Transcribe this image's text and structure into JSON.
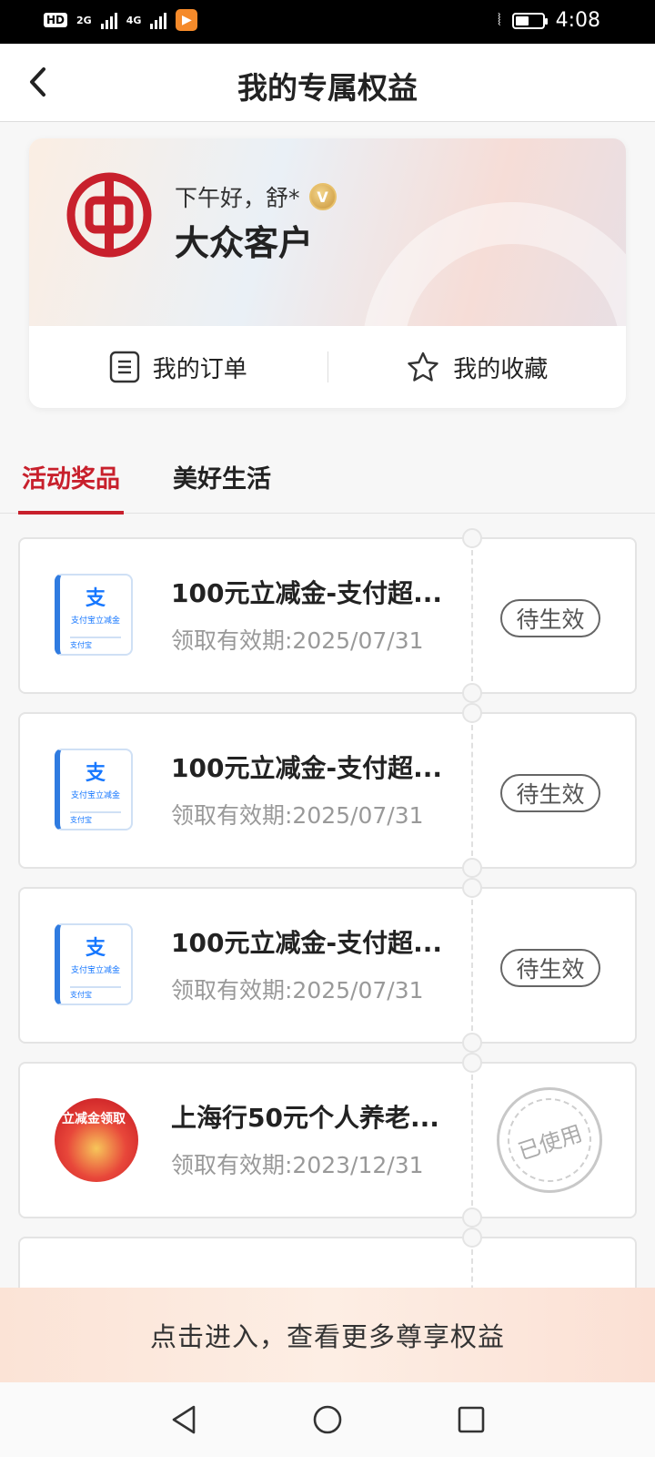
{
  "status_bar": {
    "hd": "HD",
    "net1": "2G",
    "net2": "4G",
    "time": "4:08"
  },
  "header": {
    "title": "我的专属权益"
  },
  "profile": {
    "greeting": "下午好，舒*",
    "vip_badge": "V",
    "tier": "大众客户",
    "orders_label": "我的订单",
    "favorites_label": "我的收藏"
  },
  "tabs": [
    {
      "label": "活动奖品",
      "active": true
    },
    {
      "label": "美好生活",
      "active": false
    }
  ],
  "coupons": [
    {
      "title": "100元立减金-支付超...",
      "date": "领取有效期:2025/07/31",
      "status": "待生效",
      "thumb": "alipay-coupon"
    },
    {
      "title": "100元立减金-支付超...",
      "date": "领取有效期:2025/07/31",
      "status": "待生效",
      "thumb": "alipay-coupon"
    },
    {
      "title": "100元立减金-支付超...",
      "date": "领取有效期:2025/07/31",
      "status": "待生效",
      "thumb": "alipay-coupon"
    },
    {
      "title": "上海行50元个人养老...",
      "date": "领取有效期:2023/12/31",
      "status": "已使用",
      "thumb": "promo-image"
    }
  ],
  "alipay_thumb": {
    "glyph": "支",
    "caption": "支付宝立减金",
    "footer": "支付宝"
  },
  "promo_thumb": {
    "caption": "立减金领取"
  },
  "bottom_banner": {
    "text": "点击进入，查看更多尊享权益"
  },
  "colors": {
    "accent": "#c8202c",
    "status_bar": "#000000",
    "background": "#f7f7f7"
  }
}
